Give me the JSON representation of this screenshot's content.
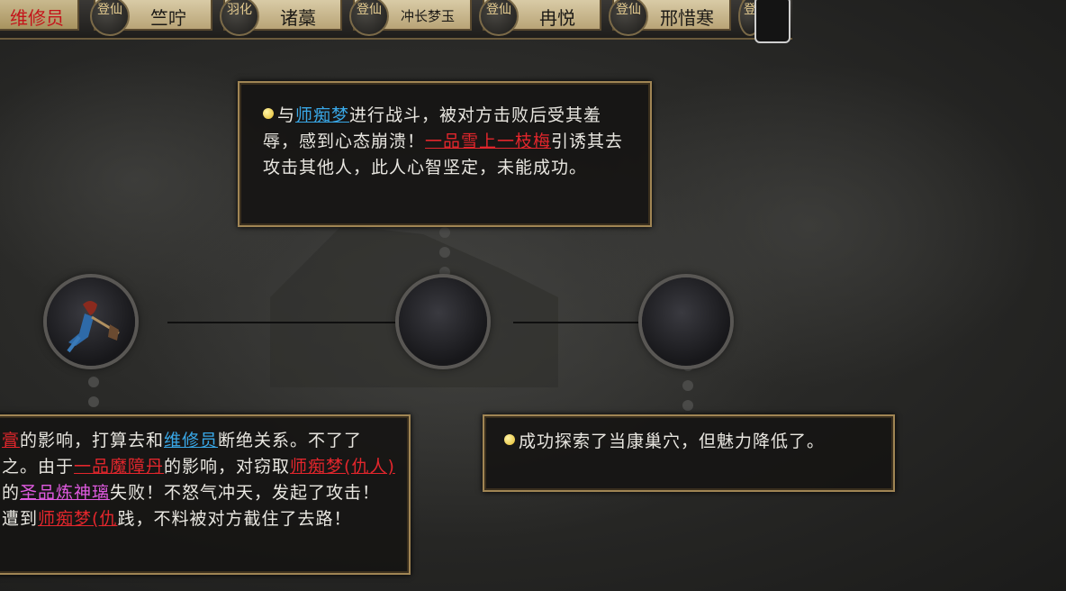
{
  "topbar": {
    "first_tab": "维修员",
    "tabs": [
      {
        "seal": "登仙",
        "name": "竺咛"
      },
      {
        "seal": "羽化",
        "name": "诸藁"
      },
      {
        "seal": "登仙",
        "name": "冲长梦玉"
      },
      {
        "seal": "登仙",
        "name": "冉悦"
      },
      {
        "seal": "登仙",
        "name": "邢惜寒"
      }
    ],
    "trailing_seal": "登"
  },
  "events": {
    "top": {
      "pre": "与",
      "link1": "师痴梦",
      "mid": "进行战斗，被对方击败后受其羞辱，感到心态崩溃！",
      "link2": "一品雪上一枝梅",
      "post": "引诱其去攻击其他人，此人心智坚定，未能成功。"
    },
    "left": {
      "link1": "膏",
      "t1": "的影响，打算去和",
      "link2": "维修员",
      "t2": "断绝关系。不了了之。由于",
      "link3": "一品魔障丹",
      "t3": "的影响，对窃取",
      "link4": "师痴梦(仇人)",
      "t4": "的",
      "link5": "圣品炼神璃",
      "t5": "失败！不怒气冲天，发起了攻击！遭到",
      "link6": "师痴梦(仇",
      "t6": "践，不料被对方截住了去路！"
    },
    "right": {
      "text": "成功探索了当康巢穴，但魅力降低了。"
    }
  },
  "colors": {
    "link_blue": "#39a7e6",
    "link_red": "#e2262c",
    "link_pink": "#e05ae0",
    "frame_gold": "#a08554"
  }
}
